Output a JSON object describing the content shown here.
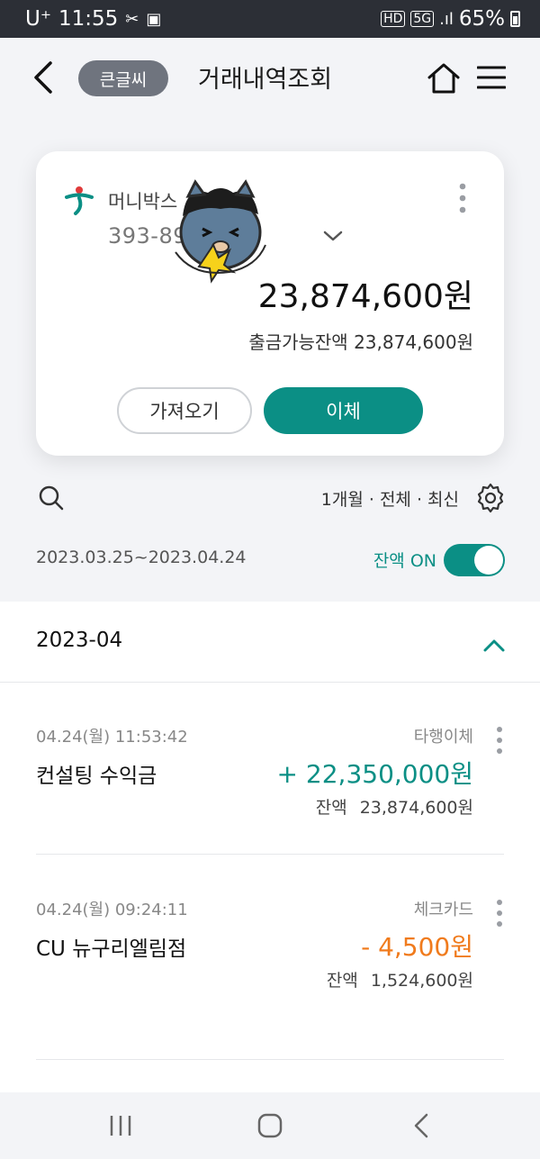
{
  "status_bar": {
    "carrier": "U⁺",
    "time": "11:55",
    "battery": "65%",
    "network": "5G",
    "hd": "HD"
  },
  "app_bar": {
    "large_text_label": "큰글씨",
    "title": "거래내역조회"
  },
  "account_card": {
    "name": "머니박스",
    "number": "393-89        515",
    "balance": "23,874,600원",
    "available_label": "출금가능잔액",
    "available_amount": "23,874,600원",
    "import_button": "가져오기",
    "transfer_button": "이체"
  },
  "filters": {
    "summary": "1개월 · 전체 · 최신",
    "date_range": "2023.03.25~2023.04.24",
    "balance_toggle_label": "잔액 ON",
    "balance_toggle_on": true
  },
  "transactions": {
    "month": "2023-04",
    "balance_label": "잔액",
    "items": [
      {
        "datetime": "04.24(월) 11:53:42",
        "type": "타행이체",
        "title": "컨설팅 수익금",
        "amount": "+ 22,350,000원",
        "direction": "in",
        "balance": "23,874,600원"
      },
      {
        "datetime": "04.24(월) 09:24:11",
        "type": "체크카드",
        "title": "CU 뉴구리엘림점",
        "amount": "- 4,500원",
        "direction": "out",
        "balance": "1,524,600원"
      }
    ]
  },
  "colors": {
    "accent": "#0b8f85",
    "withdrawal": "#f07b1d",
    "statusbar": "#2c2f36",
    "pill": "#6f747e"
  }
}
